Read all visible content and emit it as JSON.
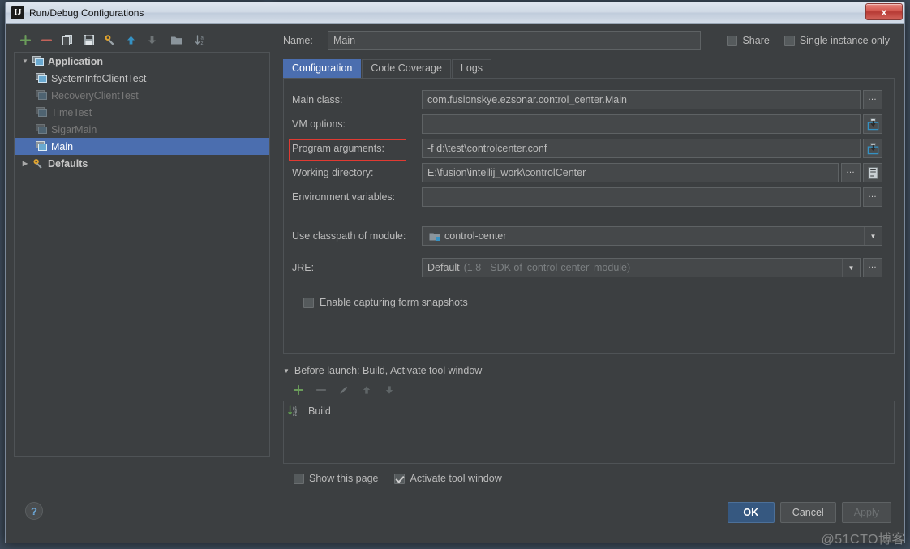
{
  "window": {
    "title": "Run/Debug Configurations",
    "app_icon": "IJ",
    "close_label": "x"
  },
  "tree_toolbar": [
    {
      "name": "add-configuration-button",
      "icon": "plus-icon",
      "label": "+"
    },
    {
      "name": "remove-configuration-button",
      "icon": "minus-icon",
      "label": "−"
    },
    {
      "name": "copy-configuration-button",
      "icon": "copy-icon",
      "label": ""
    },
    {
      "name": "save-configuration-button",
      "icon": "save-icon",
      "label": ""
    },
    {
      "name": "edit-defaults-button",
      "icon": "wrench-icon",
      "label": ""
    },
    {
      "name": "move-up-button",
      "icon": "arrow-up-icon",
      "label": ""
    },
    {
      "name": "move-down-button",
      "icon": "arrow-down-icon",
      "label": ""
    },
    {
      "name": "create-folder-button",
      "icon": "folder-icon",
      "label": ""
    },
    {
      "name": "sort-configurations-button",
      "icon": "sort-az-icon",
      "label": ""
    }
  ],
  "tree": {
    "items": [
      {
        "label": "Application",
        "type": "group",
        "expanded": true,
        "state": "group",
        "icon": "application-icon"
      },
      {
        "label": "SystemInfoClientTest",
        "type": "config",
        "state": "bright",
        "icon": "application-icon"
      },
      {
        "label": "RecoveryClientTest",
        "type": "config",
        "state": "dim",
        "icon": "application-icon"
      },
      {
        "label": "TimeTest",
        "type": "config",
        "state": "dim",
        "icon": "application-icon"
      },
      {
        "label": "SigarMain",
        "type": "config",
        "state": "dim",
        "icon": "application-icon"
      },
      {
        "label": "Main",
        "type": "config",
        "state": "selected",
        "icon": "application-icon"
      },
      {
        "label": "Defaults",
        "type": "group",
        "expanded": false,
        "state": "group",
        "icon": "wrench-icon"
      }
    ]
  },
  "header": {
    "name_label": "Name:",
    "name_value": "Main",
    "share_label": "Share",
    "share_checked": false,
    "single_instance_label": "Single instance only",
    "single_instance_checked": false
  },
  "tabs": [
    {
      "label": "Configuration",
      "active": true
    },
    {
      "label": "Code Coverage",
      "active": false
    },
    {
      "label": "Logs",
      "active": false
    }
  ],
  "configuration": {
    "main_class": {
      "label": "Main class:",
      "value": "com.fusionskye.ezsonar.control_center.Main",
      "side_button": "browse-ellipsis"
    },
    "vm_options": {
      "label": "VM options:",
      "value": "",
      "side_button": "expand-editor"
    },
    "program_arguments": {
      "label": "Program arguments:",
      "value": "-f d:\\test\\controlcenter.conf",
      "side_button": "expand-editor",
      "highlighted": true,
      "highlight_color": "#e03a32"
    },
    "working_directory": {
      "label": "Working directory:",
      "value": "E:\\fusion\\intellij_work\\controlCenter",
      "side_button": "browse-ellipsis",
      "side_button_2": "insert-macro"
    },
    "environment_variables": {
      "label": "Environment variables:",
      "value": "",
      "side_button": "browse-ellipsis"
    },
    "classpath_module": {
      "label": "Use classpath of module:",
      "value": "control-center",
      "icon": "module-icon"
    },
    "jre": {
      "label": "JRE:",
      "value": "Default",
      "value_detail": "(1.8 - SDK of 'control-center' module)",
      "side_button": "browse-ellipsis"
    },
    "form_snapshots": {
      "label": "Enable capturing form snapshots",
      "checked": false
    }
  },
  "before_launch": {
    "header": "Before launch: Build, Activate tool window",
    "expanded": true,
    "toolbar": [
      {
        "name": "add-task-button",
        "icon": "plus-icon"
      },
      {
        "name": "remove-task-button",
        "icon": "minus-icon"
      },
      {
        "name": "edit-task-button",
        "icon": "pencil-icon"
      },
      {
        "name": "move-task-up-button",
        "icon": "arrow-up-icon"
      },
      {
        "name": "move-task-down-button",
        "icon": "arrow-down-icon"
      }
    ],
    "items": [
      {
        "label": "Build",
        "icon": "build-icon"
      }
    ],
    "show_this_page": {
      "label": "Show this page",
      "checked": false
    },
    "activate_tool_window": {
      "label": "Activate tool window",
      "checked": true
    }
  },
  "footer": {
    "help_label": "?",
    "ok_label": "OK",
    "cancel_label": "Cancel",
    "apply_label": "Apply",
    "apply_disabled": true
  },
  "watermark": "@51CTO博客"
}
